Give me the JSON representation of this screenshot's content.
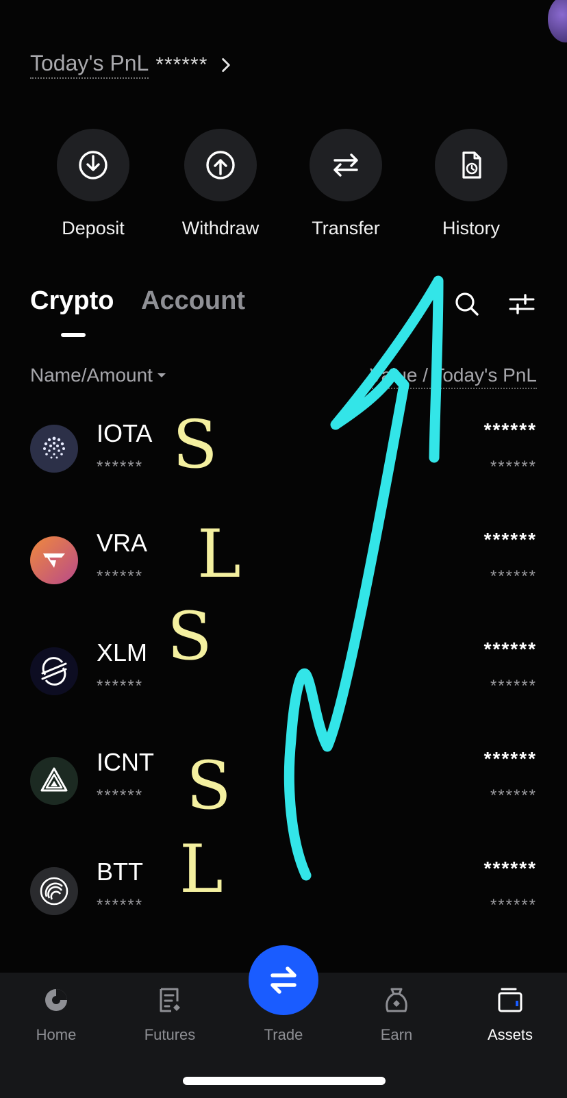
{
  "header": {
    "pnl_label": "Today's PnL",
    "pnl_value": "******"
  },
  "actions": [
    {
      "label": "Deposit",
      "icon": "deposit-icon"
    },
    {
      "label": "Withdraw",
      "icon": "withdraw-icon"
    },
    {
      "label": "Transfer",
      "icon": "transfer-icon"
    },
    {
      "label": "History",
      "icon": "history-icon"
    }
  ],
  "tabs": {
    "crypto": "Crypto",
    "account": "Account",
    "active": "Crypto"
  },
  "columns": {
    "left": "Name/Amount",
    "right": "Value / Today's PnL"
  },
  "coins": [
    {
      "name": "IOTA",
      "amount": "******",
      "value": "******",
      "pnl": "******",
      "note": "S"
    },
    {
      "name": "VRA",
      "amount": "******",
      "value": "******",
      "pnl": "******",
      "note": "L"
    },
    {
      "name": "XLM",
      "amount": "******",
      "value": "******",
      "pnl": "******",
      "note": "S"
    },
    {
      "name": "ICNT",
      "amount": "******",
      "value": "******",
      "pnl": "******",
      "note": "S"
    },
    {
      "name": "BTT",
      "amount": "******",
      "value": "******",
      "pnl": "******",
      "note": "L"
    }
  ],
  "nav": {
    "home": "Home",
    "futures": "Futures",
    "trade": "Trade",
    "earn": "Earn",
    "assets": "Assets",
    "active": "Assets"
  },
  "colors": {
    "background": "#050505",
    "accent": "#1a5cff",
    "annotation_arrow": "#33e5e8",
    "annotation_letters": "#f4f0a0"
  }
}
